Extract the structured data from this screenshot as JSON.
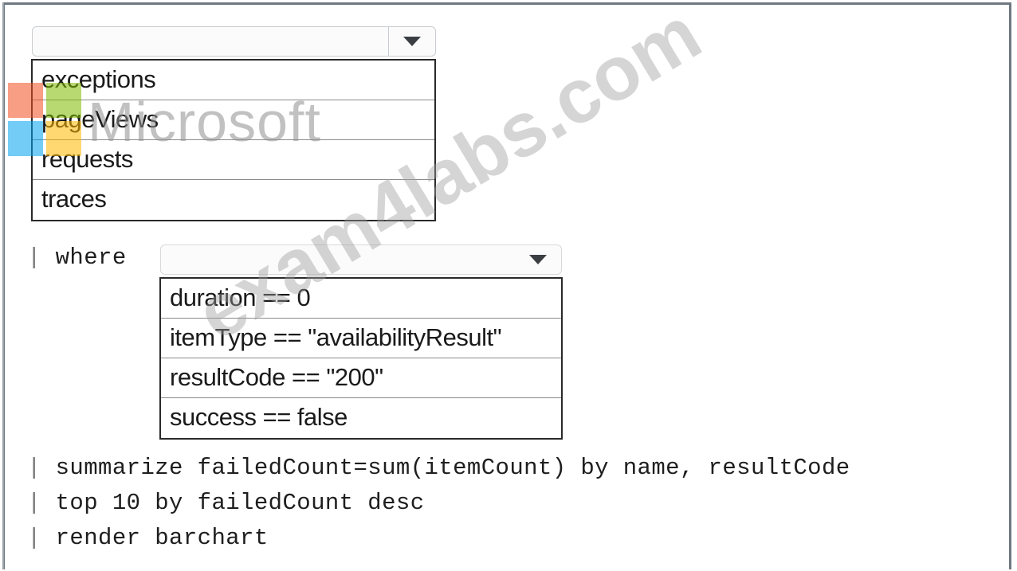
{
  "table_dropdown": {
    "selected": "",
    "options": [
      "exceptions",
      "pageViews",
      "requests",
      "traces"
    ]
  },
  "where_clause": {
    "keyword": "where",
    "selected": "",
    "options": [
      "duration == 0",
      "itemType == \"availabilityResult\"",
      "resultCode == \"200\"",
      "success == false"
    ]
  },
  "query_lines": [
    "summarize failedCount=sum(itemCount) by name, resultCode",
    "top 10 by failedCount desc",
    "render barchart"
  ],
  "pipe_char": "|",
  "watermarks": {
    "logo_text": "Microsoft",
    "site_text": "exam4labs.com",
    "logo_colors": [
      "#f25022",
      "#7fba00",
      "#00a4ef",
      "#ffb900"
    ]
  }
}
